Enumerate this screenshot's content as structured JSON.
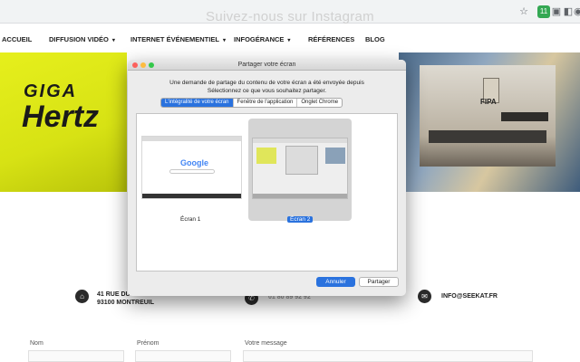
{
  "browser": {
    "icons": [
      "star-icon",
      "extension-icon",
      "extension-icon",
      "extension-icon",
      "extension-icon"
    ],
    "badge_text": "11"
  },
  "page": {
    "faded_heading": "Suivez-nous sur Instagram"
  },
  "nav": {
    "items": [
      {
        "label": "ACCUEIL"
      },
      {
        "label": "DIFFUSION VIDÉO",
        "caret": "▾"
      },
      {
        "label": "INTERNET ÉVÉNEMENTIEL",
        "caret": "▾"
      },
      {
        "label": "INFOGÉRANCE",
        "caret": "▾"
      },
      {
        "label": "RÉFÉRENCES"
      },
      {
        "label": "BLOG"
      }
    ]
  },
  "banner": {
    "brand_line1": "GIGA",
    "brand_line2": "Hertz",
    "poster_text": "FIPA"
  },
  "contact": {
    "address_line1": "41 RUE DU",
    "address_line2": "93100 MONTREUIL",
    "phone": "01 80 89 92 92",
    "email": "INFO@SEEKAT.FR"
  },
  "form": {
    "nom_label": "Nom",
    "prenom_label": "Prénom",
    "message_label": "Votre message"
  },
  "dialog": {
    "title": "Partager votre écran",
    "message_line1": "Une demande de partage du contenu de votre écran a été envoyée depuis",
    "message_line2": "Sélectionnez ce que vous souhaitez partager.",
    "tabs": [
      {
        "label": "L'intégralité de votre écran",
        "active": true
      },
      {
        "label": "Fenêtre de l'application",
        "active": false
      },
      {
        "label": "Onglet Chrome",
        "active": false
      }
    ],
    "screens": [
      {
        "label": "Écran 1",
        "selected": false
      },
      {
        "label": "Écran 2",
        "selected": true
      }
    ],
    "thumb_google": "Google",
    "cancel_label": "Annuler",
    "share_label": "Partager"
  },
  "colors": {
    "accent": "#2a72de",
    "banner_yellow": "#e6ef1c"
  }
}
